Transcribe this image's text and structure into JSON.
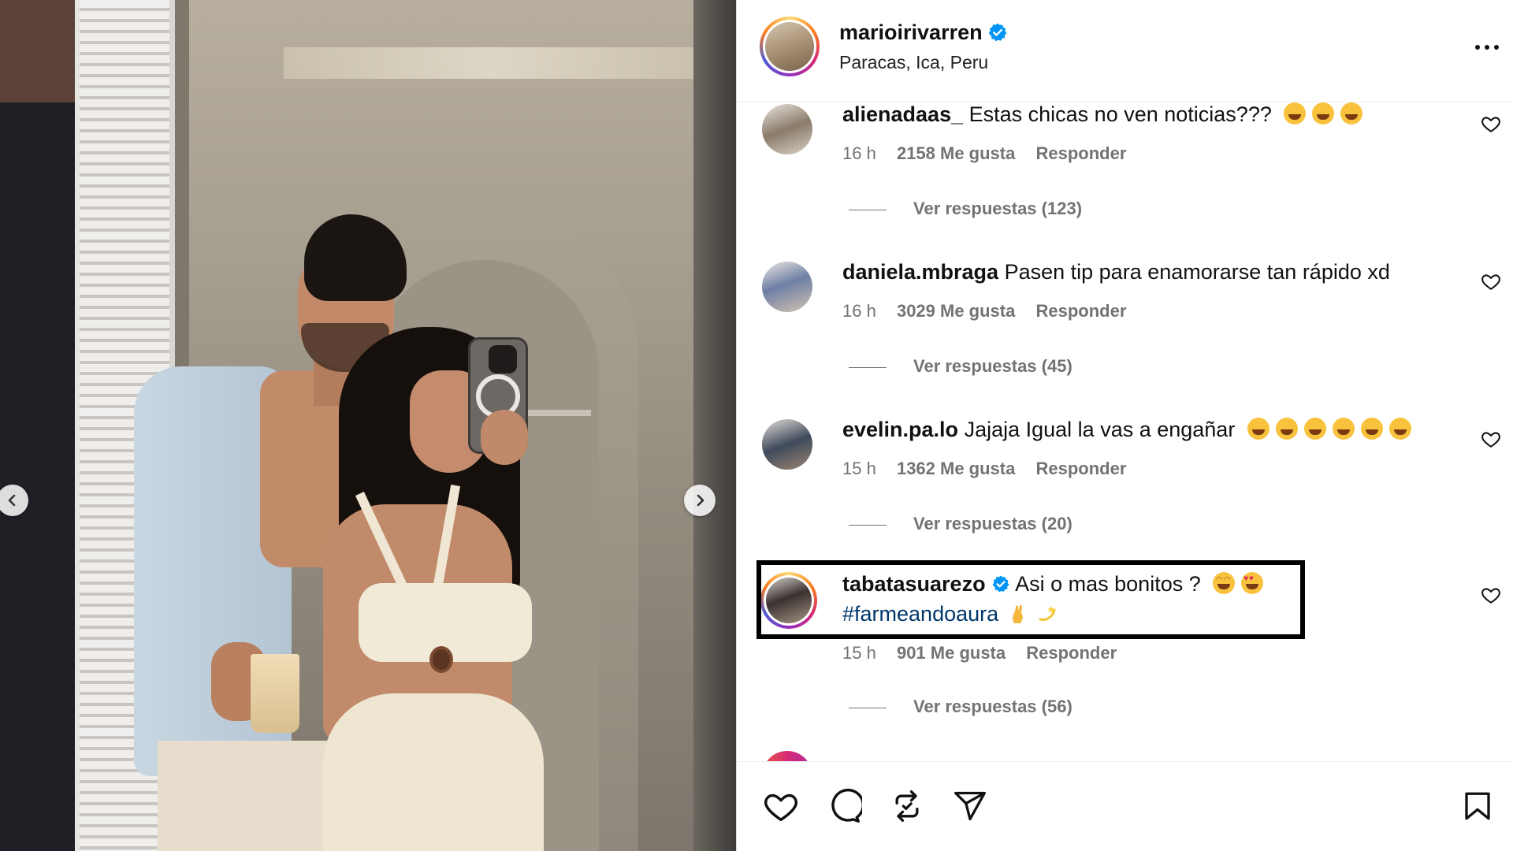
{
  "post": {
    "owner": {
      "username": "marioirivarren",
      "location": "Paracas, Ica, Peru",
      "verified": true
    },
    "photo": {
      "description_icon": "photo-carousel"
    }
  },
  "comments": [
    {
      "username": "alienadaas_",
      "text": "Estas chicas no ven noticias???",
      "emojis": [
        "laughing-emoji",
        "laughing-emoji",
        "laughing-emoji"
      ],
      "time": "16 h",
      "likes": "2158 Me gusta",
      "reply": "Responder",
      "view_replies": "Ver respuestas (123)"
    },
    {
      "username": "daniela.mbraga",
      "text": "Pasen tip para enamorarse tan rápido xd",
      "time": "16 h",
      "likes": "3029 Me gusta",
      "reply": "Responder",
      "view_replies": "Ver respuestas (45)"
    },
    {
      "username": "evelin.pa.lo",
      "text": "Jajaja Igual la vas a engañar",
      "emojis": [
        "laughing-emoji",
        "laughing-emoji",
        "laughing-emoji",
        "laughing-emoji",
        "laughing-emoji",
        "laughing-emoji"
      ],
      "time": "15 h",
      "likes": "1362 Me gusta",
      "reply": "Responder",
      "view_replies": "Ver respuestas (20)"
    },
    {
      "username": "tabatasuarezo",
      "verified": true,
      "text": "Asi o mas bonitos ?",
      "hashtag": "#farmeandoaura",
      "emojis": [
        "smiling-emoji",
        "heart-eyes-emoji",
        "pinched-fingers-emoji",
        "dizzy-emoji"
      ],
      "time": "15 h",
      "likes": "901 Me gusta",
      "reply": "Responder",
      "view_replies": "Ver respuestas (56)",
      "highlighted": true
    }
  ],
  "colors": {
    "verified_blue": "#0095f6",
    "hashtag": "#00376b",
    "meta_gray": "#737373",
    "highlight_border": "#000000"
  },
  "icons": [
    "chevron-left-icon",
    "chevron-right-icon",
    "more-icon",
    "heart-icon",
    "comment-icon",
    "repost-icon",
    "share-icon",
    "bookmark-icon",
    "verified-badge-icon"
  ]
}
